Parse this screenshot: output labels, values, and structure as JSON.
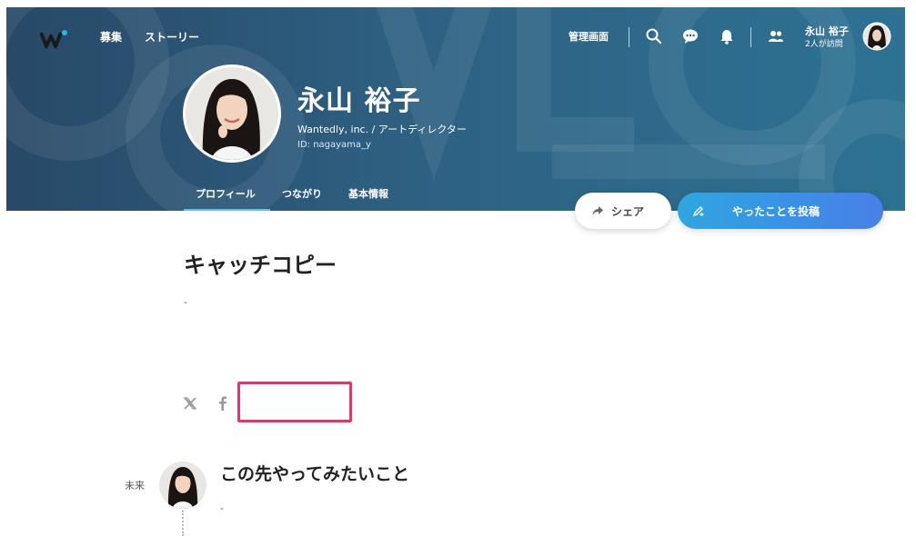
{
  "header": {
    "nav": {
      "jobs": "募集",
      "stories": "ストーリー"
    },
    "admin": "管理画面",
    "icons": [
      "search-icon",
      "chat-icon",
      "bell-icon",
      "people-icon"
    ],
    "user": {
      "name": "永山 裕子",
      "visits": "2人が訪問"
    }
  },
  "profile": {
    "name": "永山 裕子",
    "company_role": "Wantedly, inc. / アートディレクター",
    "id": "ID: nagayama_y"
  },
  "tabs": [
    {
      "label": "プロフィール",
      "active": true
    },
    {
      "label": "つながり",
      "active": false
    },
    {
      "label": "基本情報",
      "active": false
    }
  ],
  "actions": {
    "share": "シェア",
    "post": "やったことを投稿"
  },
  "catchcopy": {
    "title": "キャッチコピー",
    "value": "-"
  },
  "social_icons": [
    "x-icon",
    "facebook-icon"
  ],
  "future": {
    "label": "未来",
    "title": "この先やってみたいこと",
    "value": "-"
  },
  "colors": {
    "header_start": "#284967",
    "header_end": "#2d7293",
    "accent": "#3b8fe6",
    "tab_underline": "#55c4ee",
    "highlight": "#e6336f",
    "logo_dot": "#2fb5e6"
  }
}
